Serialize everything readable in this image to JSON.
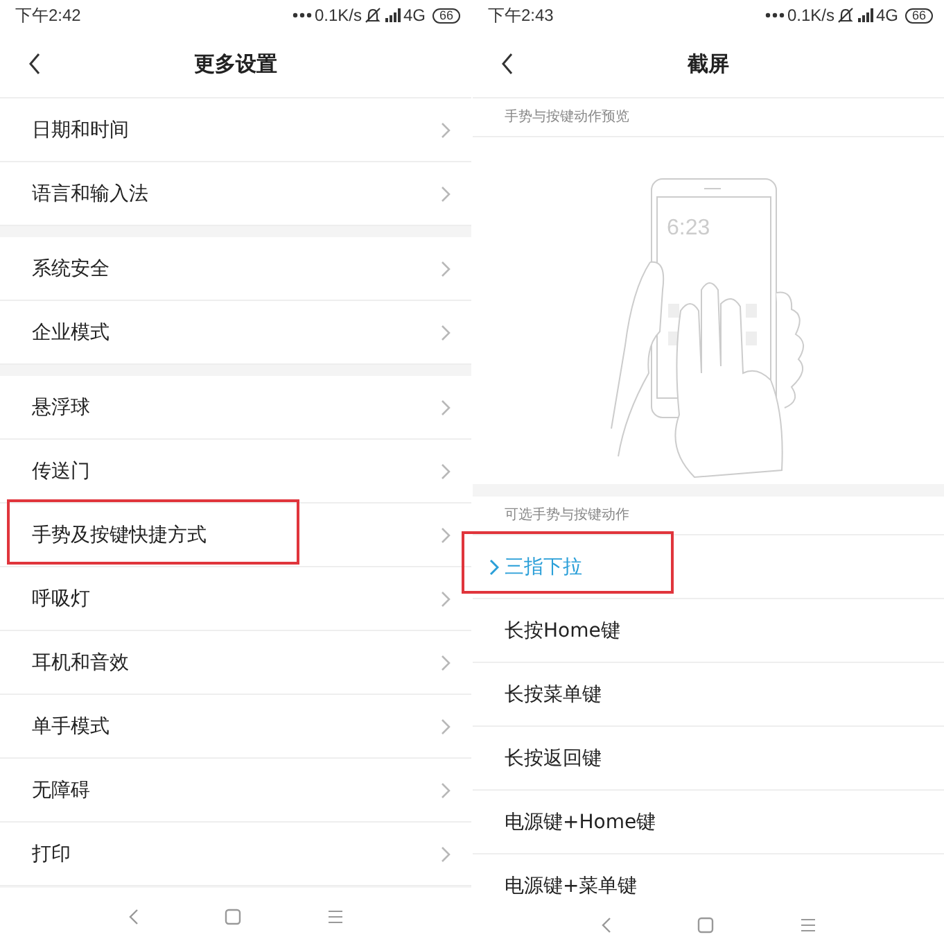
{
  "screens": [
    {
      "status_bar": {
        "time": "下午2:42",
        "speed": "0.1K/s",
        "network": "4G",
        "battery": "66"
      },
      "header": {
        "title": "更多设置"
      },
      "groups": [
        {
          "items": [
            {
              "label": "日期和时间",
              "highlighted": false
            },
            {
              "label": "语言和输入法",
              "highlighted": false
            }
          ]
        },
        {
          "items": [
            {
              "label": "系统安全",
              "highlighted": false
            },
            {
              "label": "企业模式",
              "highlighted": false
            }
          ]
        },
        {
          "items": [
            {
              "label": "悬浮球",
              "highlighted": false
            },
            {
              "label": "传送门",
              "highlighted": false
            },
            {
              "label": "手势及按键快捷方式",
              "highlighted": true
            },
            {
              "label": "呼吸灯",
              "highlighted": false
            },
            {
              "label": "耳机和音效",
              "highlighted": false
            },
            {
              "label": "单手模式",
              "highlighted": false
            },
            {
              "label": "无障碍",
              "highlighted": false
            },
            {
              "label": "打印",
              "highlighted": false
            }
          ]
        }
      ]
    },
    {
      "status_bar": {
        "time": "下午2:43",
        "speed": "0.1K/s",
        "network": "4G",
        "battery": "66"
      },
      "header": {
        "title": "截屏"
      },
      "preview": {
        "label": "手势与按键动作预览",
        "clock": "6:23"
      },
      "options": {
        "label": "可选手势与按键动作",
        "items": [
          {
            "label": "三指下拉",
            "selected": true,
            "highlighted": true
          },
          {
            "label": "长按Home键",
            "selected": false,
            "highlighted": false
          },
          {
            "label": "长按菜单键",
            "selected": false,
            "highlighted": false
          },
          {
            "label": "长按返回键",
            "selected": false,
            "highlighted": false
          },
          {
            "label": "电源键+Home键",
            "selected": false,
            "highlighted": false
          },
          {
            "label": "电源键+菜单键",
            "selected": false,
            "highlighted": false
          }
        ]
      }
    }
  ]
}
